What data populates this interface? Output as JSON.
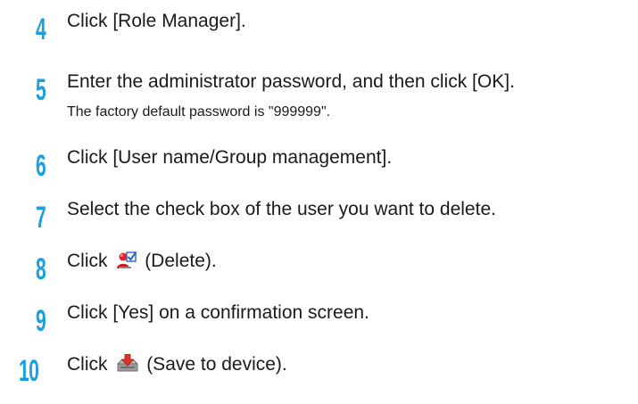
{
  "steps": [
    {
      "number": "4",
      "text": "Click [Role Manager]."
    },
    {
      "number": "5",
      "text": "Enter the administrator password, and then click [OK].",
      "note": "The factory default password is \"999999\"."
    },
    {
      "number": "6",
      "text": "Click [User name/Group management]."
    },
    {
      "number": "7",
      "text": "Select the check box of the user you want to delete."
    },
    {
      "number": "8",
      "prefix": "Click",
      "suffix": "(Delete).",
      "icon": "delete-user-icon"
    },
    {
      "number": "9",
      "text": "Click [Yes] on a confirmation screen."
    },
    {
      "number": "10",
      "prefix": "Click",
      "suffix": "(Save to device).",
      "icon": "save-to-device-icon"
    }
  ],
  "colors": {
    "step_number": "#1aa0dc",
    "text": "#1a1a1a"
  }
}
